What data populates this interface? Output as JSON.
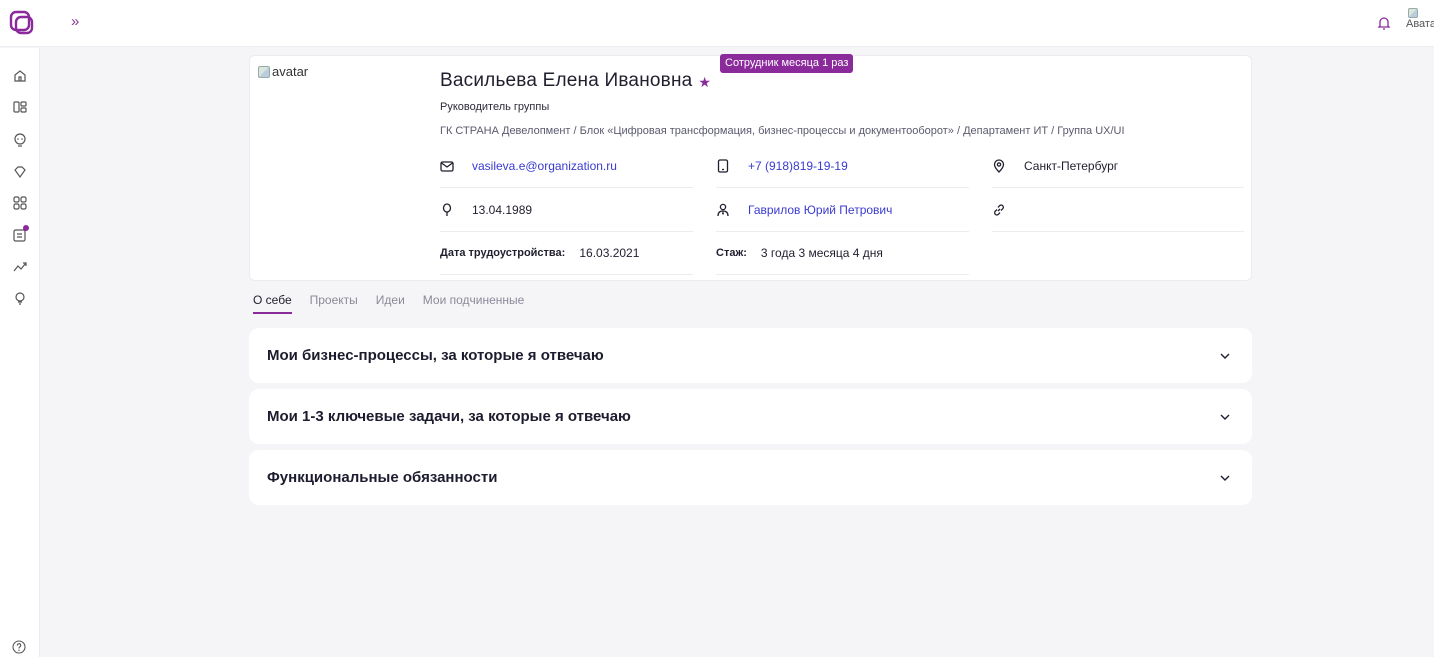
{
  "header": {
    "expand_label": "»",
    "avatar_alt": "Аватар"
  },
  "profile": {
    "avatar_alt": "avatar",
    "name": "Васильева Елена Ивановна",
    "badge": "Сотрудник месяца 1 раз",
    "position": "Руководитель группы",
    "path": "ГК СТРАНА Девелопмент / Блок «Цифровая трансформация, бизнес-процессы и документооборот» / Департамент ИТ / Группа UX/UI",
    "email": "vasileva.e@organization.ru",
    "phone": "+7 (918)819-19-19",
    "city": "Санкт-Петербург",
    "birthday": "13.04.1989",
    "manager": "Гаврилов Юрий Петрович",
    "hire_label": "Дата трудоустройства:",
    "hire_date": "16.03.2021",
    "tenure_label": "Стаж:",
    "tenure": "3 года 3 месяца 4 дня"
  },
  "tabs": [
    {
      "label": "О себе",
      "active": true
    },
    {
      "label": "Проекты"
    },
    {
      "label": "Идеи"
    },
    {
      "label": "Мои подчиненные"
    }
  ],
  "accordions": [
    {
      "title": "Мои бизнес-процессы, за которые я отвечаю"
    },
    {
      "title": "Мои 1-3 ключевые задачи, за которые я отвечаю"
    },
    {
      "title": "Функциональные обязанности"
    }
  ],
  "colors": {
    "accent": "#8a2a9b",
    "link": "#3a3ad0",
    "background": "#f5f5f7"
  }
}
